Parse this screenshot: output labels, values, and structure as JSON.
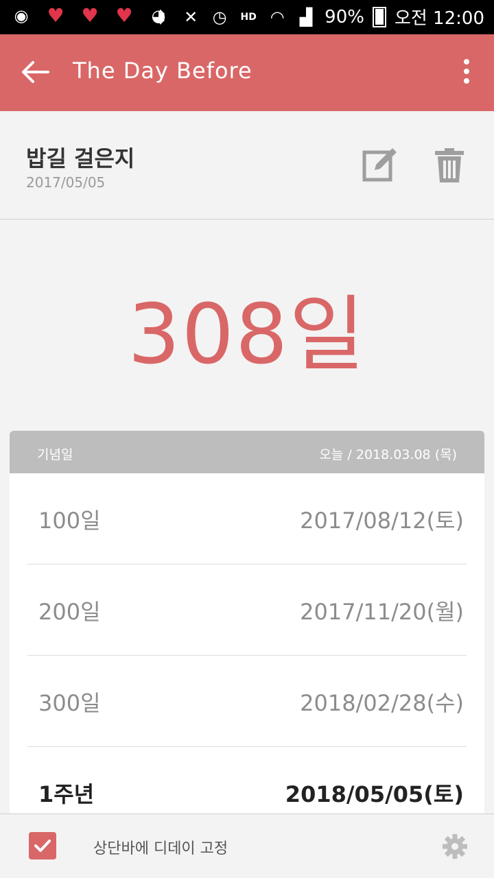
{
  "status_bar": {
    "battery": "90%",
    "time": "오전 12:00",
    "icons": [
      "camera-icon",
      "heart-icon",
      "heart-icon",
      "heart-icon",
      "notification-icon",
      "bluetooth-icon",
      "mute-icon",
      "alarm-icon",
      "hd-voice-icon",
      "wifi-icon",
      "signal-icon",
      "battery-icon"
    ]
  },
  "app_bar": {
    "title": "The Day Before",
    "background": "#d96767"
  },
  "event": {
    "name": "밥길 걸은지",
    "date": "2017/05/05"
  },
  "count": "308일",
  "milestones": {
    "header_left": "기념일",
    "header_right": "오늘 / 2018.03.08 (목)",
    "rows": [
      {
        "label": "100일",
        "date": "2017/08/12(토)"
      },
      {
        "label": "200일",
        "date": "2017/11/20(월)"
      },
      {
        "label": "300일",
        "date": "2018/02/28(수)"
      },
      {
        "label": "1주년",
        "date": "2018/05/05(토)"
      }
    ]
  },
  "bottom": {
    "pin_label": "상단바에 디데이 고정",
    "checked": true
  }
}
